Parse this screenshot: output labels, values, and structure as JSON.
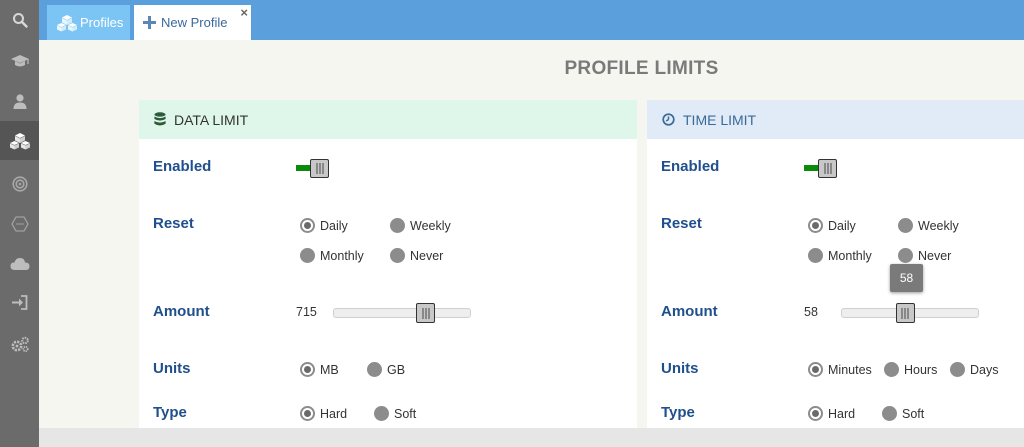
{
  "tabs": {
    "profiles_label": "Profiles",
    "new_profile_label": "New Profile",
    "close_glyph": "×"
  },
  "page": {
    "title": "PROFILE LIMITS"
  },
  "data_limit": {
    "header": "DATA LIMIT",
    "enabled_label": "Enabled",
    "reset_label": "Reset",
    "reset_options": [
      "Daily",
      "Weekly",
      "Monthly",
      "Never"
    ],
    "reset_selected": "Daily",
    "amount_label": "Amount",
    "amount_value": "715",
    "amount_fraction": 0.68,
    "units_label": "Units",
    "units_options": [
      "MB",
      "GB"
    ],
    "units_selected": "MB",
    "type_label": "Type",
    "type_options": [
      "Hard",
      "Soft"
    ],
    "type_selected": "Hard"
  },
  "time_limit": {
    "header": "TIME LIMIT",
    "enabled_label": "Enabled",
    "reset_label": "Reset",
    "reset_options": [
      "Daily",
      "Weekly",
      "Monthly",
      "Never"
    ],
    "reset_selected": "Daily",
    "amount_label": "Amount",
    "amount_value": "58",
    "amount_tooltip": "58",
    "amount_fraction": 0.47,
    "units_label": "Units",
    "units_options": [
      "Minutes",
      "Hours",
      "Days"
    ],
    "units_selected": "Minutes",
    "type_label": "Type",
    "type_options": [
      "Hard",
      "Soft"
    ],
    "type_selected": "Hard"
  },
  "colors": {
    "topbar": "#5ba0dc",
    "sidebar": "#6b6b6b",
    "label_blue": "#1f4f8c",
    "toggle_on": "#0a8c0a"
  },
  "icons": {
    "sidebar": [
      "search-icon",
      "graduation-cap-icon",
      "user-icon",
      "cubes-icon",
      "target-icon",
      "hexagon-icon",
      "cloud-icon",
      "sign-in-icon",
      "cogs-icon"
    ],
    "data_header": "database-icon",
    "time_header": "clock-icon"
  }
}
